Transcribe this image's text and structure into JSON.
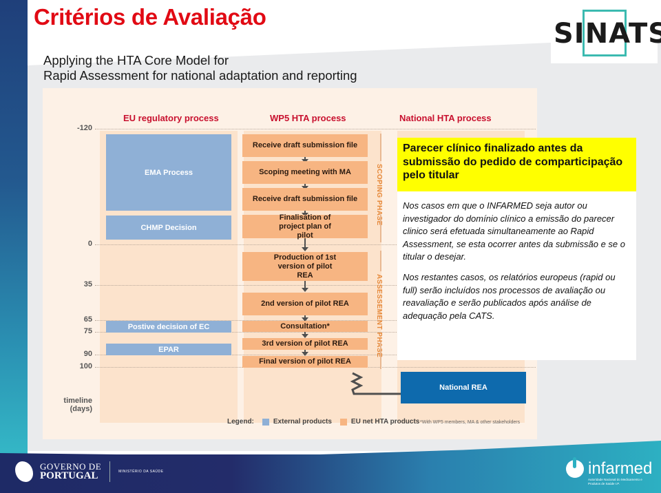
{
  "slide": {
    "title": "Critérios de Avaliação",
    "subtitle_line1": "Applying the HTA Core Model for",
    "subtitle_line2": "Rapid Assessment for national adaptation and reporting"
  },
  "logos": {
    "top_right": "SINATS",
    "footer_left_line1": "GOVERNO DE",
    "footer_left_line2": "PORTUGAL",
    "footer_left_ministry": "MINISTÉRIO DA SAÚDE",
    "footer_right": "infarmed",
    "footer_right_sub": "Autoridade Nacional do Medicamento e Produtos de Saúde I.P."
  },
  "diagram": {
    "columns": {
      "eu": "EU regulatory process",
      "wp5": "WP5 HTA process",
      "national": "National HTA process"
    },
    "timeline_ticks": [
      "-120",
      "0",
      "35",
      "65",
      "75",
      "90",
      "100"
    ],
    "timeline_label_line1": "timeline",
    "timeline_label_line2": "(days)",
    "eu_boxes": [
      "EMA Process",
      "CHMP Decision",
      "Postive decision of EC",
      "EPAR"
    ],
    "wp5_steps": [
      "Receive draft submission file",
      "Scoping meeting with MA",
      "Receive draft submission file",
      "Finalisation of project plan of pilot",
      "Production of 1st version of pilot REA",
      "2nd version of pilot REA",
      "Consultation*",
      "3rd version of pilot REA",
      "Final version of pilot REA"
    ],
    "phases": [
      "SCOPING PHASE",
      "ASSESSEMENT PHASE"
    ],
    "national_box": "National REA",
    "legend": {
      "label": "Legend:",
      "items": [
        {
          "label": "External products",
          "color": "#8fb0d6"
        },
        {
          "label": "EU net HTA products",
          "color": "#f7b582"
        }
      ]
    },
    "footnote": "*With WP5 members, MA & other stakeholders"
  },
  "overlay": {
    "highlight": "Parecer clínico finalizado antes da submissão do pedido de comparticipação pelo titular",
    "paragraph1": "Nos casos em que o INFARMED seja autor ou investigador do domínio clínico a emissão do parecer clinico será efetuada simultaneamente ao Rapid Assessment, se esta ocorrer antes da submissão e se o titular o desejar.",
    "paragraph2": "Nos restantes casos, os relatórios europeus (rapid ou full) serão incluídos nos processos de avaliação ou reavaliação e serão publicados após análise de adequação pela CATS."
  }
}
